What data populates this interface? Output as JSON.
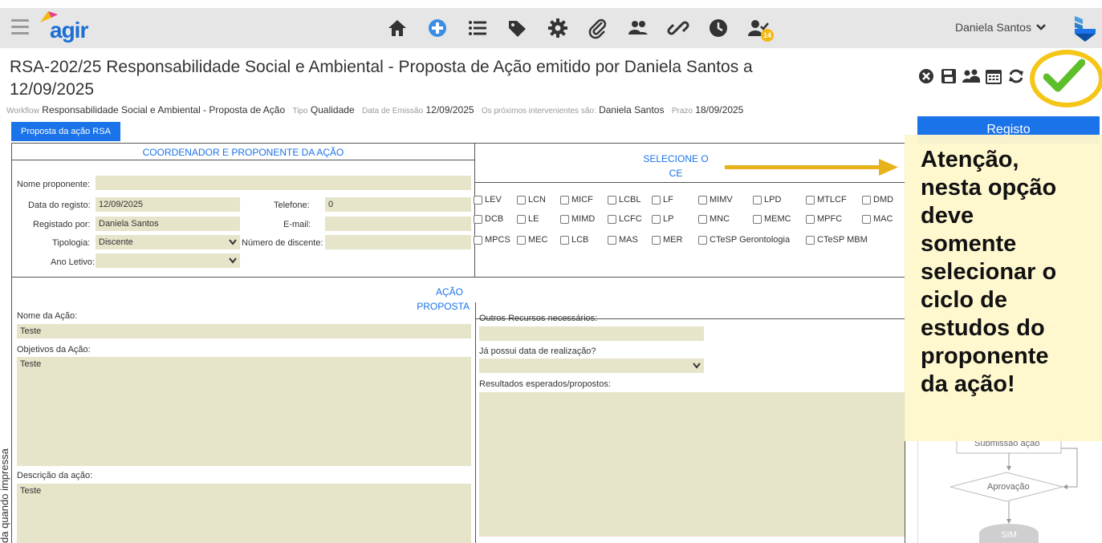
{
  "app": {
    "logo_text": "agir"
  },
  "nav": {
    "icons": [
      "home-icon",
      "add-circle-icon",
      "list-icon",
      "tags-icon",
      "gear-icon",
      "paperclip-icon",
      "users-icon",
      "link-icon",
      "clock-icon",
      "user-check-icon"
    ],
    "badge_count": "14"
  },
  "user": {
    "name": "Daniela Santos",
    "caret": "⌄"
  },
  "title": "RSA-202/25 Responsabilidade Social e Ambiental - Proposta de Ação emitido por Daniela Santos a 12/09/2025",
  "meta": {
    "workflow_label": "Workflow",
    "workflow_value": "Responsabilidade Social e Ambiental - Proposta de Ação",
    "tipo_label": "Tipo",
    "tipo_value": "Qualidade",
    "emissao_label": "Data de Emissão",
    "emissao_value": "12/09/2025",
    "intervenientes_label": "Os próximos intervenientes são:",
    "intervenientes_value": "Daniela Santos",
    "prazo_label": "Prazo",
    "prazo_value": "18/09/2025"
  },
  "tab": {
    "label": "Proposta da ação RSA"
  },
  "right_panel": {
    "registo_label": "Registo",
    "flow_partial_label": "Submissão ação",
    "flow_aprovacao": "Aprovação",
    "flow_sim": "SIM"
  },
  "callout": {
    "text_lines": [
      "Atenção,",
      "nesta opção",
      "deve",
      "somente",
      "selecionar o",
      "ciclo de",
      "estudos do",
      "proponente",
      "da ação!"
    ]
  },
  "section_coordenador": {
    "heading": "COORDENADOR E PROPONENTE DA AÇÃO",
    "nome_label": "Nome proponente:",
    "nome_value": "",
    "data_label": "Data do registo:",
    "data_value": "12/09/2025",
    "telefone_label": "Telefone:",
    "telefone_value": "0",
    "registado_label": "Registado por:",
    "registado_value": "Daniela Santos",
    "email_label": "E-mail:",
    "email_value": "",
    "tipologia_label": "Tipologia:",
    "tipologia_value": "Discente",
    "num_discente_label": "Número de discente:",
    "num_discente_value": "",
    "ano_label": "Ano Letivo:",
    "ano_value": ""
  },
  "section_ce": {
    "heading_line1": "SELECIONE O",
    "heading_line2": "CE",
    "row1": [
      "LEV",
      "LCN",
      "MICF",
      "LCBL",
      "LF",
      "MIMV",
      "LPD",
      "MTLCF",
      "DMD"
    ],
    "row2": [
      "DCB",
      "LE",
      "MIMD",
      "LCFC",
      "LP",
      "MNC",
      "MEMC",
      "MPFC",
      "MAC"
    ],
    "row3": [
      "MPCS",
      "MEC",
      "LCB",
      "MAS",
      "MER",
      "CTeSP Gerontologia",
      "CTeSP MBM"
    ]
  },
  "section_acao": {
    "heading_line1": "AÇÃO",
    "heading_line2": "PROPOSTA",
    "nome_label": "Nome da Ação:",
    "nome_value": "Teste",
    "objetivos_label": "Objetivos da Ação:",
    "objetivos_value": "Teste",
    "descricao_label": "Descrição da ação:",
    "descricao_value": "Teste",
    "recursos_label": "Outros Recursos necessários:",
    "recursos_value": "",
    "data_real_label": "Já possui data de realização?",
    "data_real_value": "",
    "resultados_label": "Resultados esperados/propostos:",
    "resultados_value": ""
  },
  "side_text": "da quando impressa",
  "colors": {
    "accent": "#1a73e8",
    "field_bg": "#e6e4c9",
    "highlight": "#f5c518",
    "check": "#5cbf2a"
  }
}
